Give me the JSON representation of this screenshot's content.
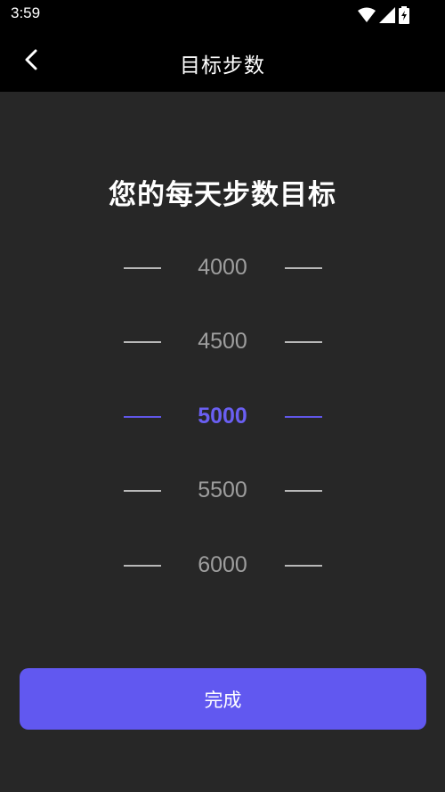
{
  "status_bar": {
    "time": "3:59",
    "icons": [
      "wifi-icon",
      "signal-icon",
      "battery-icon"
    ]
  },
  "app_bar": {
    "back_icon": "chevron-left-icon",
    "title": "目标步数"
  },
  "heading": "您的每天步数目标",
  "picker": {
    "items": [
      "4000",
      "4500",
      "5000",
      "5500",
      "6000"
    ],
    "selected": "5000"
  },
  "done_button": {
    "label": "完成"
  },
  "colors": {
    "background": "#272727",
    "bar": "#000000",
    "accent": "#6158f0",
    "unselected_text": "#9e9e9e"
  }
}
